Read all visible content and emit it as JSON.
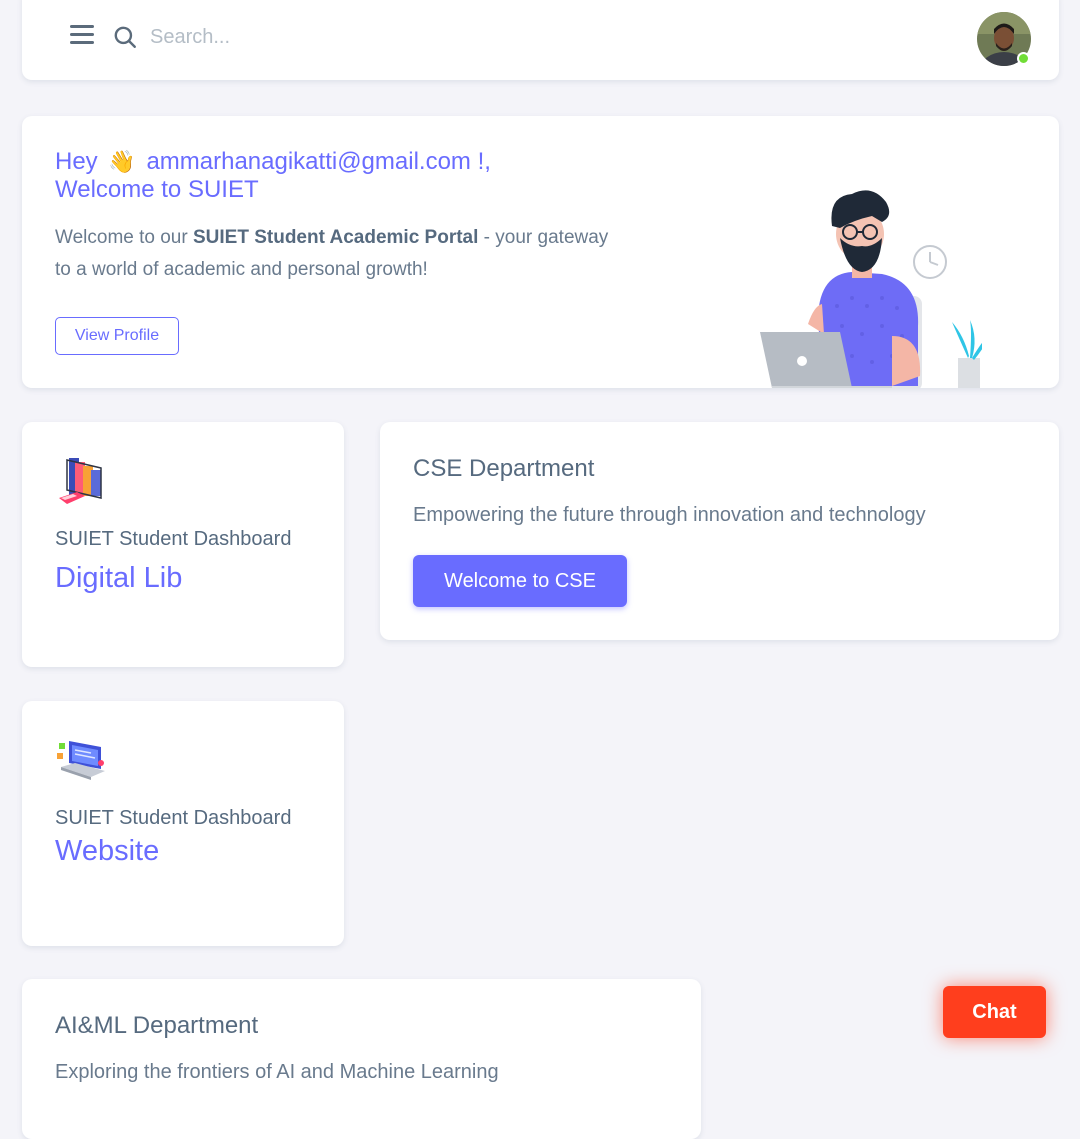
{
  "navbar": {
    "search_placeholder": "Search..."
  },
  "welcome": {
    "greeting": "Hey",
    "email": "ammarhanagikatti@gmail.com !,",
    "title_line2": "Welcome to SUIET",
    "text_prefix": "Welcome to our ",
    "text_bold": "SUIET Student Academic Portal",
    "text_suffix": " - your gateway to a world of academic and personal growth!",
    "view_profile_label": "View Profile"
  },
  "cards": {
    "digital_lib": {
      "subtitle": "SUIET Student Dashboard",
      "title": "Digital Lib"
    },
    "website": {
      "subtitle": "SUIET Student Dashboard",
      "title": "Website"
    }
  },
  "cse": {
    "title": "CSE Department",
    "description": "Empowering the future through innovation and technology",
    "button_label": "Welcome to CSE"
  },
  "aiml": {
    "title": "AI&ML Department",
    "description": "Exploring the frontiers of AI and Machine Learning"
  },
  "chat": {
    "label": "Chat"
  },
  "colors": {
    "primary": "#696cff",
    "danger": "#ff3e1d",
    "online": "#71dd37",
    "background": "#f4f4f9"
  }
}
